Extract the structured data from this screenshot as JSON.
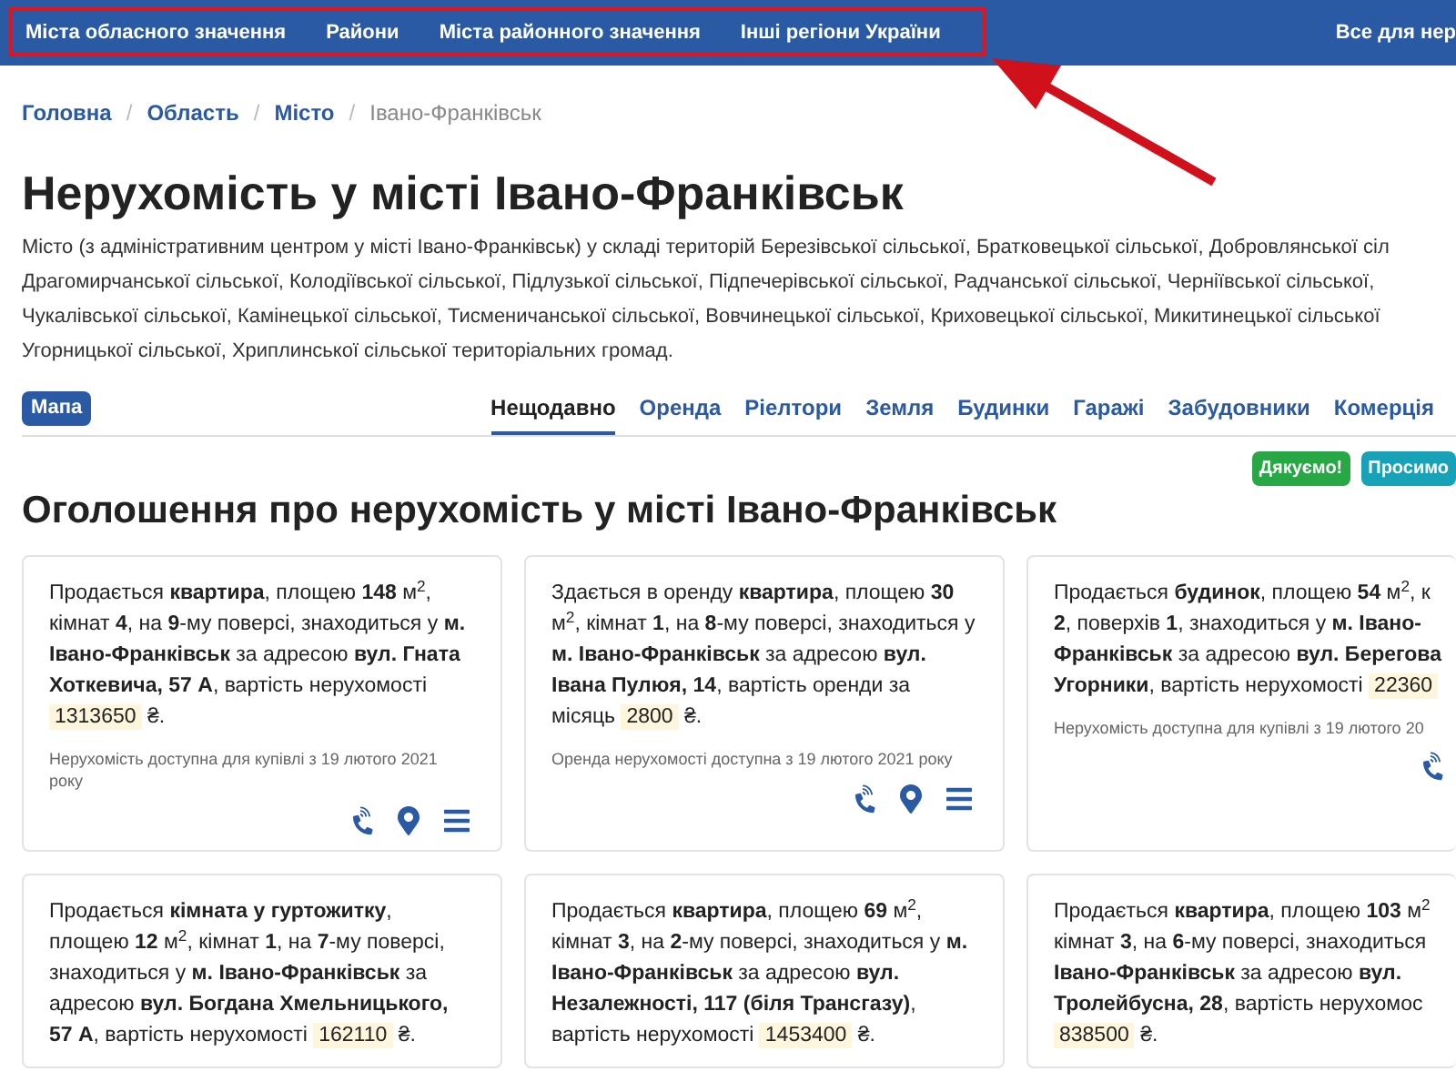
{
  "topnav": {
    "items": [
      "Міста обласного значення",
      "Райони",
      "Міста районного значення",
      "Інші регіони України"
    ],
    "right": "Все для нер"
  },
  "breadcrumbs": [
    {
      "label": "Головна",
      "current": false
    },
    {
      "sep": "/",
      "label": "Область",
      "current": false
    },
    {
      "sep": "/",
      "label": "Місто",
      "current": false
    },
    {
      "sep": "/",
      "label": "Івано-Франківськ",
      "current": true
    }
  ],
  "title": "Нерухомість у місті Івано-Франківськ",
  "description": "Місто (з адміністративним центром у місті Івано-Франківськ) у складі територій Березівської сільської, Братковецької сільської, Добровлянської сіл Драгомирчанської сільської, Колодіївської сільської, Підлузької сільської, Підпечерівської сільської, Радчанської сільської, Черніївської сільської, Чукалівської сільської, Камінецької сільської, Тисменичанської сільської, Вовчинецької сільської, Криховецької сільської, Микитинецької сільської Угорницької сільської, Хриплинської сільської територіальних громад.",
  "map_badge": "Мапа",
  "tabs": [
    {
      "label": "Нещодавно",
      "selected": true
    },
    {
      "label": "Оренда",
      "selected": false
    },
    {
      "label": "Ріелтори",
      "selected": false
    },
    {
      "label": "Земля",
      "selected": false
    },
    {
      "label": "Будинки",
      "selected": false
    },
    {
      "label": "Гаражі",
      "selected": false
    },
    {
      "label": "Забудовники",
      "selected": false
    },
    {
      "label": "Комерція",
      "selected": false
    }
  ],
  "pills": [
    {
      "label": "Дякуємо!",
      "color": "#28a745"
    },
    {
      "label": "Просимо",
      "color": "#17a2b8"
    }
  ],
  "section_title": "Оголошення про нерухомість у місті Івано-Франківськ",
  "cards": [
    {
      "text": "Продається **квартира**, площею **148** м$^{2}$, кімнат **4**, на **9**-му поверсі, знаходиться у **м. Івано-Франківськ** за адресою **вул. Гната Хоткевича, 57 А**, вартість нерухомості",
      "price": "1313650",
      "currency": "₴.",
      "note": "Нерухомість доступна для купівлі з 19 лютого 2021 року",
      "actions": [
        {
          "kind": "phone"
        },
        {
          "kind": "map"
        },
        {
          "kind": "menu"
        }
      ]
    },
    {
      "text": "Здається в оренду **квартира**, площею **30** м$^{2}$, кімнат **1**, на **8**-му поверсі, знаходиться у **м. Івано-Франківськ** за адресою **вул. Івана Пулюя, 14**, вартість оренди за місяць",
      "price": "2800",
      "currency": "₴.",
      "note": "Оренда нерухомості доступна з 19 лютого 2021 року",
      "actions": [
        {
          "kind": "phone"
        },
        {
          "kind": "map"
        },
        {
          "kind": "menu"
        }
      ]
    },
    {
      "text": "Продається **будинок**, площею **54** м$^{2}$, к **2**, поверхів **1**, знаходиться у **м. Івано- Франківськ** за адресою **вул. Берегова Угорники**, вартість нерухомості",
      "price": "22360",
      "note": "Нерухомість доступна для купівлі з 19 лютого 20",
      "actions": [
        {
          "kind": "phone"
        }
      ]
    },
    {
      "text": "Продається **кімната у гуртожитку**, площею **12** м$^{2}$, кімнат **1**, на **7**-му поверсі, знаходиться у **м. Івано-Франківськ** за адресою **вул. Богдана Хмельницького, 57 А**, вартість нерухомості",
      "price": "162110",
      "currency": "₴."
    },
    {
      "text": "Продається **квартира**, площею **69** м$^{2}$, кімнат **3**, на **2**-му поверсі, знаходиться у **м. Івано-Франківськ** за адресою **вул. Незалежності, 117 (біля Трансгазу)**, вартість нерухомості",
      "price": "1453400",
      "currency": "₴."
    },
    {
      "text": "Продається **квартира**, площею **103** м$^{2}$ кімнат **3**, на **6**-му поверсі, знаходиться **Івано-Франківськ** за адресою **вул. Тролейбусна, 28**, вартість нерухомос",
      "price": "838500",
      "currency": "₴."
    }
  ]
}
